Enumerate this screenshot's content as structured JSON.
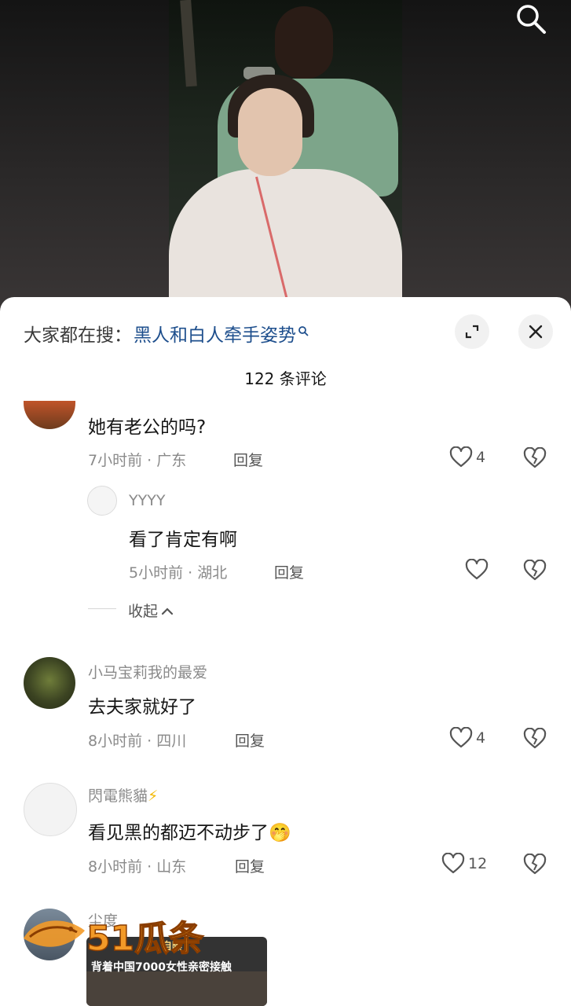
{
  "search": {
    "prefix": "大家都在搜：",
    "keyword": "黑人和白人牵手姿势"
  },
  "comment_count": "122 条评论",
  "comments": [
    {
      "text": "她有老公的吗?",
      "meta": "7小时前 · 广东",
      "reply": "回复",
      "likes": "4",
      "replies": [
        {
          "name": "YYYY",
          "text": "看了肯定有啊",
          "meta": "5小时前 · 湖北",
          "reply": "回复"
        }
      ],
      "collapse": "收起"
    },
    {
      "name": "小马宝莉我的最爱",
      "text": "去夫家就好了",
      "meta": "8小时前 · 四川",
      "reply": "回复",
      "likes": "4"
    },
    {
      "name": "閃電熊貓",
      "name_emoji": "⚡",
      "text": "看见黑的都迈不动步了",
      "emoji": "🤭",
      "meta": "8小时前 · 山东",
      "reply": "回复",
      "likes": "12"
    },
    {
      "name": "尘度"
    }
  ],
  "watermark": {
    "logo": "51瓜条",
    "tag": "自曝",
    "caption": "背着中国7000女性亲密接触"
  },
  "colors": {
    "keyword": "#1e4f8d",
    "meta": "#8a8a8a",
    "sheet": "#ffffff"
  }
}
